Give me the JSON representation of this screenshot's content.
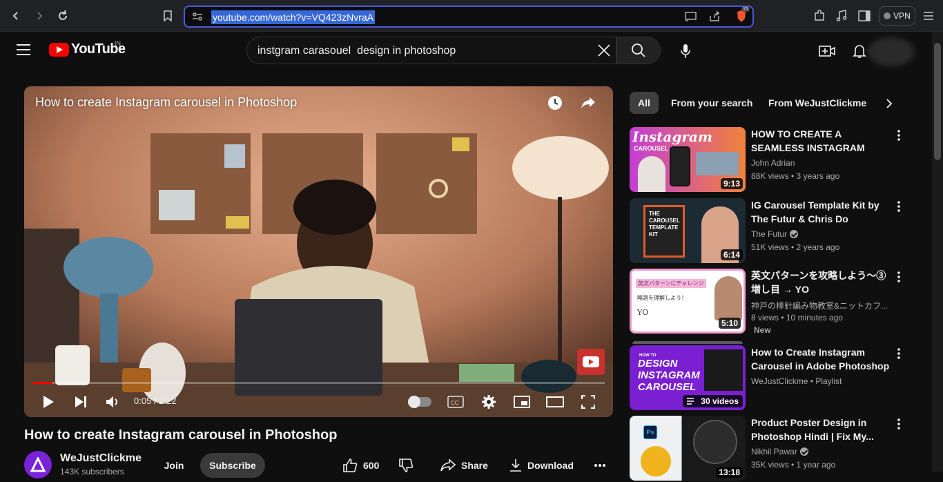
{
  "browser": {
    "url": "youtube.com/watch?v=VQ423zNvraA",
    "shields_badge": "15",
    "vpn_label": "VPN"
  },
  "header": {
    "logo_text": "YouTube",
    "region": "IN",
    "search_query": "instgram carasouel  design in photoshop"
  },
  "player": {
    "overlay_title": "How to create Instagram carousel in Photoshop",
    "time": "0:05 / 2:22",
    "progress": 0.035
  },
  "video": {
    "title": "How to create Instagram carousel in Photoshop",
    "channel": "WeJustClickme",
    "subscribers": "143K subscribers",
    "join_label": "Join",
    "subscribe_label": "Subscribe",
    "likes": "600",
    "share_label": "Share",
    "download_label": "Download"
  },
  "chips": [
    "All",
    "From your search",
    "From WeJustClickme"
  ],
  "recommendations": [
    {
      "title": "HOW TO CREATE A SEAMLESS INSTAGRAM CAROUSEL IN...",
      "channel": "John Adrian",
      "verified": false,
      "meta": "88K views • 3 years ago",
      "duration": "9:13",
      "thumb_text": "Instagram",
      "thumb_sub": "CAROUSEL"
    },
    {
      "title": "IG Carousel Template Kit by The Futur & Chris Do",
      "channel": "The Futur",
      "verified": true,
      "meta": "51K views • 2 years ago",
      "duration": "6:14",
      "thumb_text": "THE CAROUSEL TEMPLATE KIT"
    },
    {
      "title": "英文パターンを攻略しよう〜③ 増し目 → YO",
      "channel": "神戸の棒針編み物教室&ニットカフ...",
      "verified": false,
      "meta": "8 views • 10 minutes ago",
      "badge": "New",
      "duration": "5:10",
      "thumb_text": "英文パターンにチャレンジ",
      "thumb_sub": "略語を理解しよう！",
      "thumb_sub2": "YO"
    },
    {
      "title": "How to Create Instagram Carousel in Adobe Photoshop ...",
      "channel": "WeJustClickme • Playlist",
      "verified": false,
      "meta": "",
      "playlist_count": "30 videos",
      "thumb_text": "DESIGN INSTAGRAM CAROUSEL",
      "thumb_sub": "HOW TO"
    },
    {
      "title": "Product Poster Design in Photoshop Hindi | Fix My...",
      "channel": "Nikhil Pawar",
      "verified": true,
      "meta": "35K views • 1 year ago",
      "duration": "13:18"
    }
  ]
}
